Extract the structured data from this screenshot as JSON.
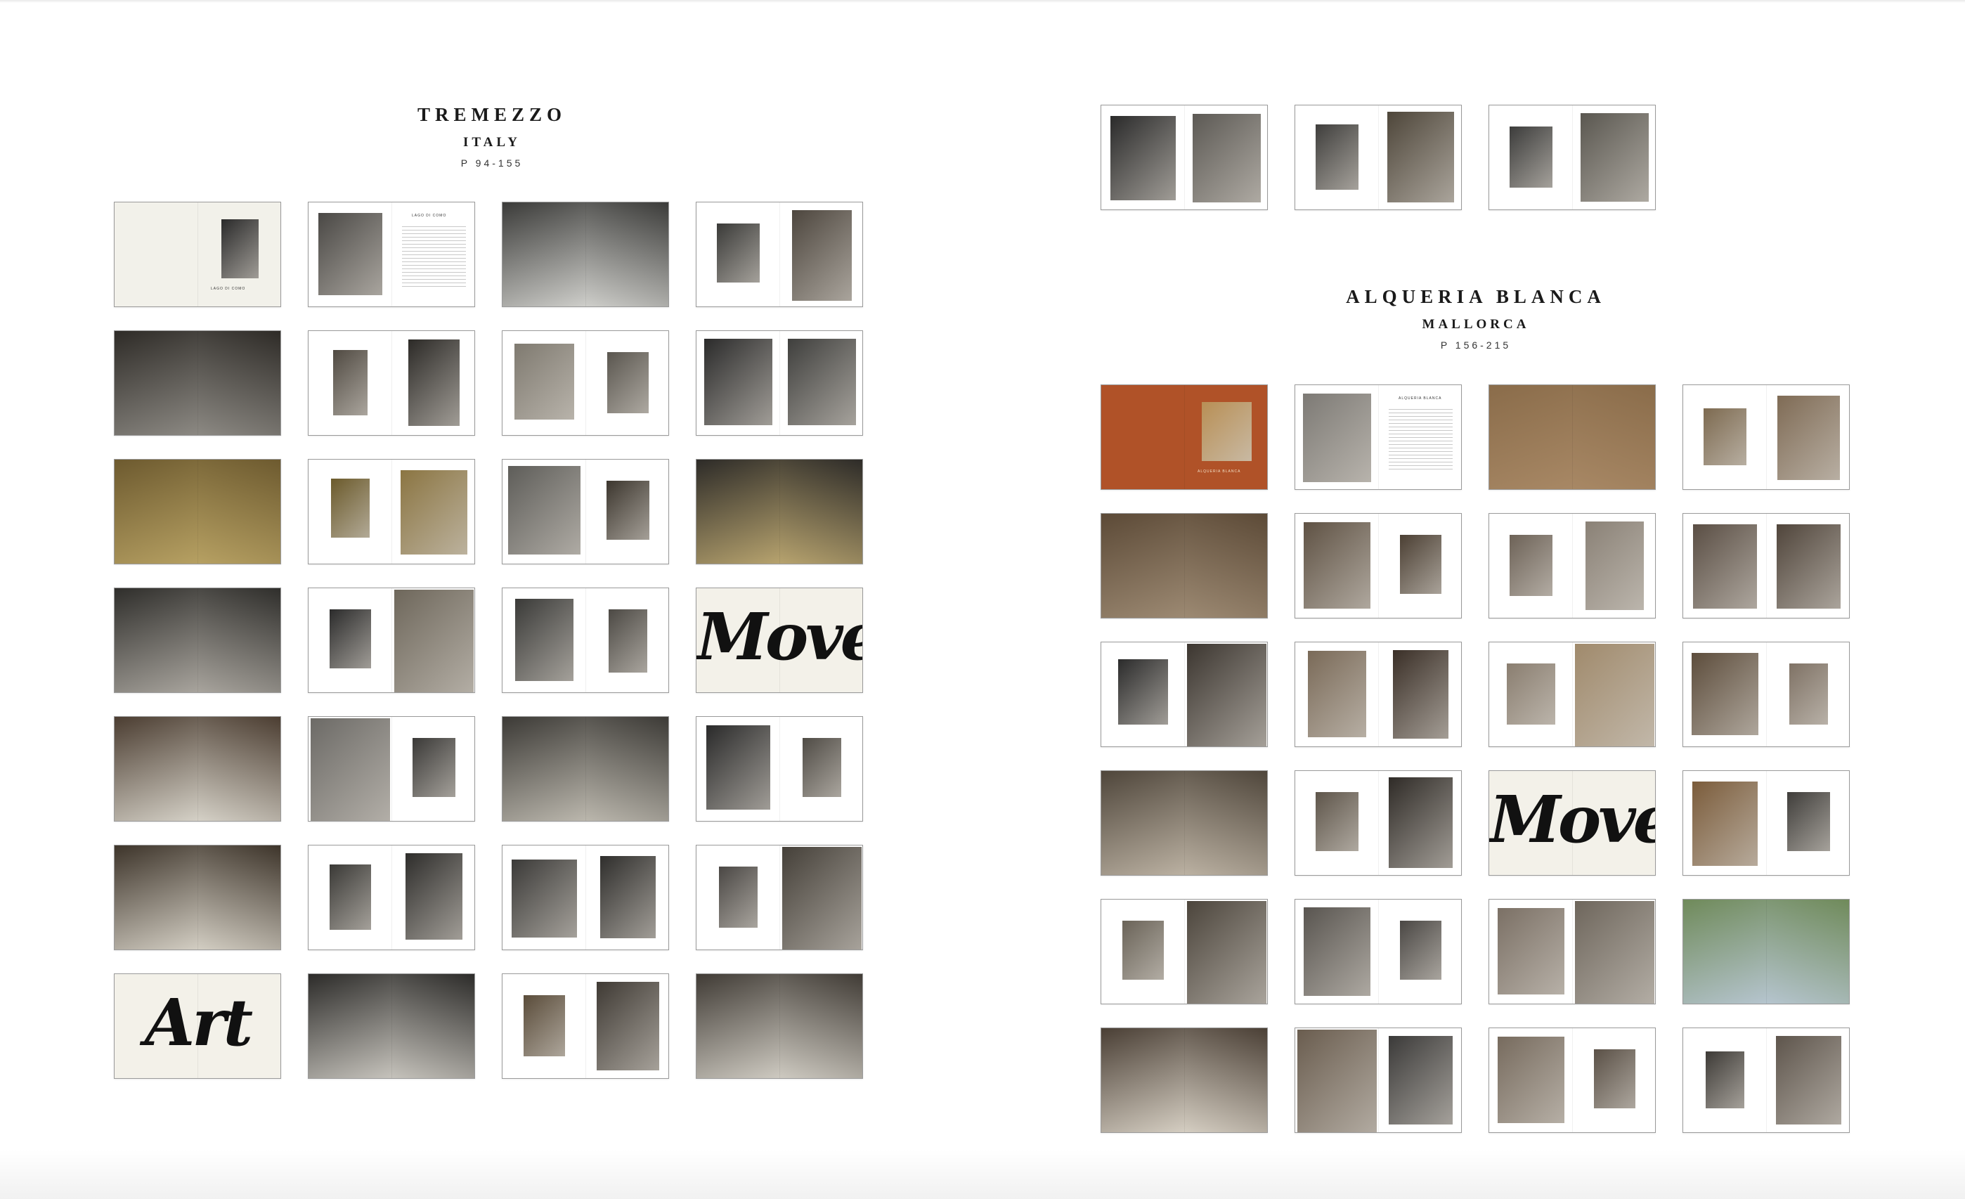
{
  "sections": [
    {
      "id": "tremezzo",
      "title": "TREMEZZO",
      "subtitle": "ITALY",
      "pages": "P 94-155",
      "cols": 4,
      "spreads": [
        {
          "type": "title",
          "L": null,
          "R": {
            "ph": "#2a2a2a",
            "w": 0.44,
            "h": 0.56,
            "y": 0.16
          },
          "bg": "#f2f1ea",
          "cap": "LAGO DI COMO"
        },
        {
          "type": "text",
          "L": {
            "ph": "#4a4845",
            "w": 0.76,
            "h": 0.78,
            "y": 0.1
          },
          "R": null,
          "cap": "LAGO DI COMO"
        },
        {
          "type": "full",
          "c1": "#3b3b39",
          "c2": "#cfcfcb"
        },
        {
          "type": "pair",
          "L": {
            "ph": "#3a3a38",
            "w": 0.52,
            "h": 0.56,
            "y": 0.2
          },
          "R": {
            "ph": "#4d463e",
            "w": 0.72,
            "h": 0.86,
            "y": 0.07
          }
        },
        {
          "type": "full",
          "c1": "#2e2b27",
          "c2": "#8d8a84"
        },
        {
          "type": "pair",
          "L": {
            "ph": "#504a42",
            "w": 0.42,
            "h": 0.62,
            "y": 0.18
          },
          "R": {
            "ph": "#2c2a27",
            "w": 0.62,
            "h": 0.82,
            "y": 0.08
          }
        },
        {
          "type": "pair",
          "L": {
            "ph": "#7f7a70",
            "w": 0.72,
            "h": 0.72,
            "y": 0.12
          },
          "R": {
            "ph": "#5a564f",
            "w": 0.5,
            "h": 0.58,
            "y": 0.2
          }
        },
        {
          "type": "pair",
          "L": {
            "ph": "#2b2b2b",
            "w": 0.82,
            "h": 0.82,
            "y": 0.07
          },
          "R": {
            "ph": "#3f3f3d",
            "w": 0.82,
            "h": 0.82,
            "y": 0.07
          }
        },
        {
          "type": "full",
          "c1": "#6d5a2f",
          "c2": "#b7a163"
        },
        {
          "type": "pair",
          "L": {
            "ph": "#6b5a2b",
            "w": 0.46,
            "h": 0.56,
            "y": 0.18
          },
          "R": {
            "ph": "#8b7542",
            "w": 0.8,
            "h": 0.8,
            "y": 0.1
          }
        },
        {
          "type": "pair",
          "L": {
            "ph": "#5e5d59",
            "w": 0.86,
            "h": 0.84,
            "y": 0.06
          },
          "R": {
            "ph": "#3c362e",
            "w": 0.52,
            "h": 0.56,
            "y": 0.2
          }
        },
        {
          "type": "full",
          "c1": "#2d2b28",
          "c2": "#b8a46f"
        },
        {
          "type": "full",
          "c1": "#2f2e2b",
          "c2": "#a9a59e"
        },
        {
          "type": "pair",
          "L": {
            "ph": "#2b2b2b",
            "w": 0.5,
            "h": 0.56,
            "y": 0.2
          },
          "R": {
            "ph": "#6e675b",
            "w": 0.95,
            "h": 0.98,
            "y": 0.01
          }
        },
        {
          "type": "pair",
          "L": {
            "ph": "#3a3a38",
            "w": 0.7,
            "h": 0.78,
            "y": 0.1
          },
          "R": {
            "ph": "#4c4944",
            "w": 0.46,
            "h": 0.6,
            "y": 0.2
          }
        },
        {
          "type": "word",
          "word": "Move"
        },
        {
          "type": "full",
          "c1": "#4b3d31",
          "c2": "#d6d2c8"
        },
        {
          "type": "pair",
          "L": {
            "ph": "#6c6a66",
            "w": 0.95,
            "h": 0.98,
            "y": 0.01
          },
          "R": {
            "ph": "#3a3937",
            "w": 0.52,
            "h": 0.56,
            "y": 0.2
          }
        },
        {
          "type": "full",
          "c1": "#3c3a36",
          "c2": "#bcb8ae"
        },
        {
          "type": "pair",
          "L": {
            "ph": "#2a2a2a",
            "w": 0.76,
            "h": 0.8,
            "y": 0.08
          },
          "R": {
            "ph": "#4f4b45",
            "w": 0.46,
            "h": 0.56,
            "y": 0.2
          }
        },
        {
          "type": "full",
          "c1": "#3d342a",
          "c2": "#d4cfc4"
        },
        {
          "type": "pair",
          "L": {
            "ph": "#3a3936",
            "w": 0.5,
            "h": 0.62,
            "y": 0.18
          },
          "R": {
            "ph": "#2e2d2b",
            "w": 0.68,
            "h": 0.82,
            "y": 0.07
          }
        },
        {
          "type": "pair",
          "L": {
            "ph": "#3b3a38",
            "w": 0.78,
            "h": 0.74,
            "y": 0.13
          },
          "R": {
            "ph": "#2f2e2c",
            "w": 0.66,
            "h": 0.78,
            "y": 0.1
          }
        },
        {
          "type": "pair",
          "L": {
            "ph": "#4a4744",
            "w": 0.46,
            "h": 0.58,
            "y": 0.2
          },
          "R": {
            "ph": "#454039",
            "w": 0.95,
            "h": 0.98,
            "y": 0.01
          }
        },
        {
          "type": "word",
          "word": "Art"
        },
        {
          "type": "full",
          "c1": "#2c2b29",
          "c2": "#c7c4bd"
        },
        {
          "type": "pair",
          "L": {
            "ph": "#5a4c3a",
            "w": 0.5,
            "h": 0.58,
            "y": 0.2
          },
          "R": {
            "ph": "#3f3a34",
            "w": 0.74,
            "h": 0.84,
            "y": 0.07
          }
        },
        {
          "type": "full",
          "c1": "#403b35",
          "c2": "#cfcbc2"
        }
      ]
    },
    {
      "id": "alqueria",
      "title": "ALQUERIA BLANCA",
      "subtitle": "MALLORCA",
      "pages": "P 156-215",
      "cols": 4,
      "spreads": [
        {
          "type": "title",
          "L": null,
          "R": {
            "ph": "#b88f55",
            "w": 0.6,
            "h": 0.56,
            "y": 0.16
          },
          "bg": "#b05228",
          "cap": "ALQUERIA BLANCA"
        },
        {
          "type": "text",
          "L": {
            "ph": "#7d7a75",
            "w": 0.82,
            "h": 0.84,
            "y": 0.08
          },
          "R": null,
          "cap": "ALQUERIA BLANCA"
        },
        {
          "type": "full",
          "c1": "#8a6c4a",
          "c2": "#a88865"
        },
        {
          "type": "pair",
          "L": {
            "ph": "#7d6a50",
            "w": 0.52,
            "h": 0.54,
            "y": 0.22
          },
          "R": {
            "ph": "#7f6b55",
            "w": 0.74,
            "h": 0.8,
            "y": 0.1
          }
        },
        {
          "type": "full",
          "c1": "#5c4a37",
          "c2": "#9d8a73"
        },
        {
          "type": "pair",
          "L": {
            "ph": "#5f5244",
            "w": 0.8,
            "h": 0.82,
            "y": 0.08
          },
          "R": {
            "ph": "#4b3f33",
            "w": 0.5,
            "h": 0.56,
            "y": 0.2
          }
        },
        {
          "type": "pair",
          "L": {
            "ph": "#6d6257",
            "w": 0.52,
            "h": 0.58,
            "y": 0.2
          },
          "R": {
            "ph": "#8a8176",
            "w": 0.7,
            "h": 0.84,
            "y": 0.07
          }
        },
        {
          "type": "pair",
          "L": {
            "ph": "#5a4e44",
            "w": 0.76,
            "h": 0.8,
            "y": 0.1
          },
          "R": {
            "ph": "#50453b",
            "w": 0.76,
            "h": 0.8,
            "y": 0.1
          }
        },
        {
          "type": "pair",
          "L": {
            "ph": "#2b2b2b",
            "w": 0.6,
            "h": 0.62,
            "y": 0.16
          },
          "R": {
            "ph": "#3c3630",
            "w": 0.95,
            "h": 0.98,
            "y": 0.01
          }
        },
        {
          "type": "pair",
          "L": {
            "ph": "#7a6a58",
            "w": 0.7,
            "h": 0.82,
            "y": 0.08
          },
          "R": {
            "ph": "#3a2f27",
            "w": 0.66,
            "h": 0.84,
            "y": 0.07
          }
        },
        {
          "type": "pair",
          "L": {
            "ph": "#8a7e70",
            "w": 0.58,
            "h": 0.58,
            "y": 0.2
          },
          "R": {
            "ph": "#a08a6c",
            "w": 0.95,
            "h": 0.98,
            "y": 0.01
          }
        },
        {
          "type": "pair",
          "L": {
            "ph": "#5d4d3c",
            "w": 0.8,
            "h": 0.78,
            "y": 0.1
          },
          "R": {
            "ph": "#7f7265",
            "w": 0.46,
            "h": 0.58,
            "y": 0.2
          }
        },
        {
          "type": "full",
          "c1": "#4f463b",
          "c2": "#bcb2a3"
        },
        {
          "type": "pair",
          "L": {
            "ph": "#5e554a",
            "w": 0.52,
            "h": 0.56,
            "y": 0.2
          },
          "R": {
            "ph": "#2f2b27",
            "w": 0.76,
            "h": 0.86,
            "y": 0.06
          }
        },
        {
          "type": "word",
          "word": "Move"
        },
        {
          "type": "pair",
          "L": {
            "ph": "#7b5c3b",
            "w": 0.78,
            "h": 0.8,
            "y": 0.1
          },
          "R": {
            "ph": "#3f3d3a",
            "w": 0.52,
            "h": 0.56,
            "y": 0.2
          }
        },
        {
          "type": "pair",
          "L": {
            "ph": "#6a6358",
            "w": 0.5,
            "h": 0.56,
            "y": 0.2
          },
          "R": {
            "ph": "#4c453c",
            "w": 0.95,
            "h": 0.98,
            "y": 0.01
          }
        },
        {
          "type": "pair",
          "L": {
            "ph": "#595550",
            "w": 0.8,
            "h": 0.84,
            "y": 0.07
          },
          "R": {
            "ph": "#4a4744",
            "w": 0.5,
            "h": 0.56,
            "y": 0.2
          }
        },
        {
          "type": "pair",
          "L": {
            "ph": "#7b7065",
            "w": 0.8,
            "h": 0.82,
            "y": 0.08
          },
          "R": {
            "ph": "#6e665c",
            "w": 0.95,
            "h": 0.98,
            "y": 0.01
          }
        },
        {
          "type": "full",
          "c1": "#6f8a5a",
          "c2": "#b6c5cf"
        },
        {
          "type": "full",
          "c1": "#4a3f35",
          "c2": "#d6cfc3"
        },
        {
          "type": "pair",
          "L": {
            "ph": "#6a5d4f",
            "w": 0.95,
            "h": 0.98,
            "y": 0.01
          },
          "R": {
            "ph": "#3b3a39",
            "w": 0.76,
            "h": 0.84,
            "y": 0.07
          }
        },
        {
          "type": "pair",
          "L": {
            "ph": "#776b5e",
            "w": 0.8,
            "h": 0.82,
            "y": 0.08
          },
          "R": {
            "ph": "#5a5046",
            "w": 0.5,
            "h": 0.56,
            "y": 0.2
          }
        },
        {
          "type": "pair",
          "L": {
            "ph": "#3d3a36",
            "w": 0.46,
            "h": 0.54,
            "y": 0.22
          },
          "R": {
            "ph": "#5e554c",
            "w": 0.78,
            "h": 0.84,
            "y": 0.07
          }
        }
      ]
    }
  ],
  "mallorca_top_row": [
    {
      "type": "pair",
      "L": {
        "ph": "#2a2a2a",
        "w": 0.78,
        "h": 0.8,
        "y": 0.1
      },
      "R": {
        "ph": "#5c5954",
        "w": 0.82,
        "h": 0.84,
        "y": 0.08
      }
    },
    {
      "type": "pair",
      "L": {
        "ph": "#3f3e3c",
        "w": 0.52,
        "h": 0.62,
        "y": 0.18
      },
      "R": {
        "ph": "#4e463a",
        "w": 0.8,
        "h": 0.86,
        "y": 0.06
      }
    },
    {
      "type": "pair",
      "L": {
        "ph": "#3c3c3b",
        "w": 0.52,
        "h": 0.58,
        "y": 0.2
      },
      "R": {
        "ph": "#5a5750",
        "w": 0.82,
        "h": 0.84,
        "y": 0.07
      }
    }
  ]
}
